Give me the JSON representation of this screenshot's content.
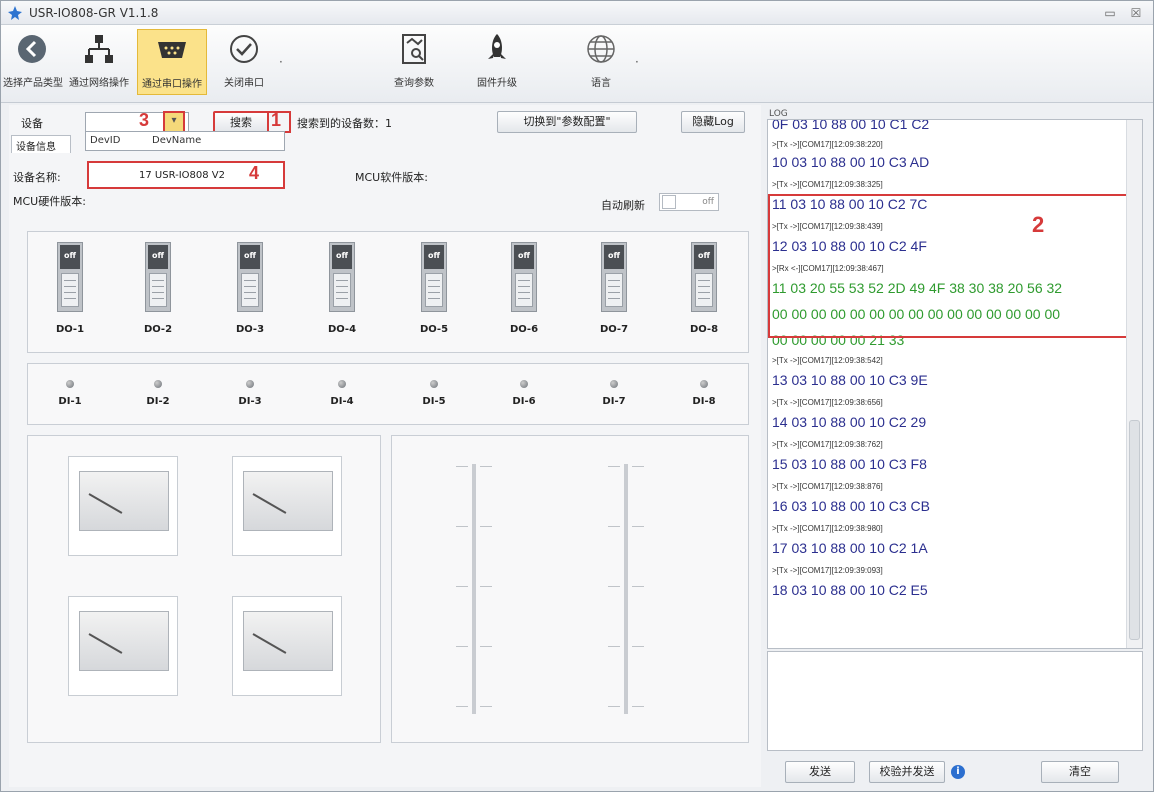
{
  "window": {
    "title": "USR-IO808-GR V1.1.8",
    "minimize_label": "▭",
    "close_label": "☒"
  },
  "toolbar": {
    "items": [
      {
        "label": "选择产品类型",
        "icon": "back-circle-icon"
      },
      {
        "label": "通过网络操作",
        "icon": "network-icon"
      },
      {
        "label": "通过串口操作",
        "icon": "serial-port-icon"
      },
      {
        "label": "关闭串口",
        "icon": "check-circle-icon"
      },
      {
        "label": "查询参数",
        "icon": "query-document-icon"
      },
      {
        "label": "固件升级",
        "icon": "rocket-icon"
      },
      {
        "label": "语言",
        "icon": "globe-icon"
      }
    ],
    "dot": "·"
  },
  "device": {
    "label": "设备",
    "arrow": "▾",
    "search_button": "搜索",
    "found_label": "搜索到的设备数：1",
    "switch_button": "切换到\"参数配置\"",
    "hide_log_button": "隐藏Log",
    "dropdown_col1": "DevID",
    "dropdown_col2": "DevName",
    "tab_label": "设备信息",
    "name_label": "设备名称:",
    "name_value": "17 USR-IO808 V2",
    "mcu_sw_label": "MCU软件版本:",
    "mcu_hw_label": "MCU硬件版本:",
    "auto_refresh_label": "自动刷新",
    "auto_refresh_state": "off"
  },
  "annotations": {
    "n1": "1",
    "n2": "2",
    "n3": "3",
    "n4": "4"
  },
  "do_outputs": [
    {
      "label": "DO-1",
      "state": "off"
    },
    {
      "label": "DO-2",
      "state": "off"
    },
    {
      "label": "DO-3",
      "state": "off"
    },
    {
      "label": "DO-4",
      "state": "off"
    },
    {
      "label": "DO-5",
      "state": "off"
    },
    {
      "label": "DO-6",
      "state": "off"
    },
    {
      "label": "DO-7",
      "state": "off"
    },
    {
      "label": "DO-8",
      "state": "off"
    }
  ],
  "di_inputs": [
    "DI-1",
    "DI-2",
    "DI-3",
    "DI-4",
    "DI-5",
    "DI-6",
    "DI-7",
    "DI-8"
  ],
  "log": {
    "title": "LOG",
    "lines": [
      {
        "type": "data",
        "text": "0F 03 10 88 00 10 C1 C2"
      },
      {
        "type": "meta",
        "text": ">[Tx ->][COM17][12:09:38:220]"
      },
      {
        "type": "data",
        "text": "10 03 10 88 00 10 C3 AD"
      },
      {
        "type": "meta",
        "text": ">[Tx ->][COM17][12:09:38:325]"
      },
      {
        "type": "data",
        "text": "11 03 10 88 00 10 C2 7C"
      },
      {
        "type": "meta",
        "text": ">[Tx ->][COM17][12:09:38:439]"
      },
      {
        "type": "data",
        "text": "12 03 10 88 00 10 C2 4F"
      },
      {
        "type": "meta",
        "text": ">[Rx <-][COM17][12:09:38:467]"
      },
      {
        "type": "green",
        "text": "11 03 20 55 53 52 2D 49 4F 38 30 38 20 56 32"
      },
      {
        "type": "green",
        "text": "00 00 00 00 00 00 00 00 00 00 00 00 00 00 00"
      },
      {
        "type": "green",
        "text": "00 00 00 00 00 21 33"
      },
      {
        "type": "meta",
        "text": ">[Tx ->][COM17][12:09:38:542]"
      },
      {
        "type": "data",
        "text": "13 03 10 88 00 10 C3 9E"
      },
      {
        "type": "meta",
        "text": ">[Tx ->][COM17][12:09:38:656]"
      },
      {
        "type": "data",
        "text": "14 03 10 88 00 10 C2 29"
      },
      {
        "type": "meta",
        "text": ">[Tx ->][COM17][12:09:38:762]"
      },
      {
        "type": "data",
        "text": "15 03 10 88 00 10 C3 F8"
      },
      {
        "type": "meta",
        "text": ">[Tx ->][COM17][12:09:38:876]"
      },
      {
        "type": "data",
        "text": "16 03 10 88 00 10 C3 CB"
      },
      {
        "type": "meta",
        "text": ">[Tx ->][COM17][12:09:38:980]"
      },
      {
        "type": "data",
        "text": "17 03 10 88 00 10 C2 1A"
      },
      {
        "type": "meta",
        "text": ">[Tx ->][COM17][12:09:39:093]"
      },
      {
        "type": "data",
        "text": "18 03 10 88 00 10 C2 E5"
      }
    ],
    "send_button": "发送",
    "checksum_send_button": "校验并发送",
    "info_glyph": "i",
    "clear_button": "清空",
    "grip": "....."
  },
  "colors": {
    "accent_yellow": "#fbe28a",
    "annotation_red": "#d63a3a",
    "log_blue": "#2b2f8f",
    "log_green": "#2f9b2f"
  }
}
